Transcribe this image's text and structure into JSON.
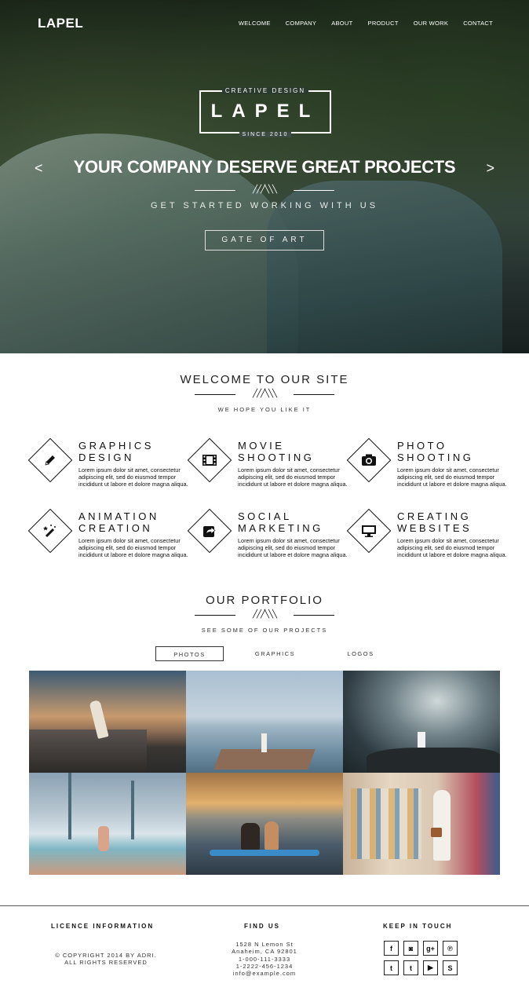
{
  "nav": {
    "logo": "LAPEL",
    "links": [
      "WELCOME",
      "COMPANY",
      "ABOUT",
      "PRODUCT",
      "OUR WORK",
      "CONTACT"
    ]
  },
  "hero": {
    "tagline": "CREATIVE DESIGN",
    "emblem": "LAPEL",
    "since": "SINCE 2010",
    "title": "YOUR COMPANY DESERVE GREAT PROJECTS",
    "subtitle": "GET STARTED WORKING WITH US",
    "button": "GATE OF ART",
    "prev": "<",
    "next": ">"
  },
  "welcome": {
    "title": "WELCOME TO OUR SITE",
    "subtitle": "WE HOPE YOU LIKE IT",
    "services": [
      {
        "line1": "GRAPHICS",
        "line2": "DESIGN",
        "icon": "pencil-icon",
        "desc": "Lorem ipsum dolor sit amet, consectetur adipiscing elit, sed do eiusmod tempor incididunt ut labore et dolore magna aliqua."
      },
      {
        "line1": "MOVIE",
        "line2": "SHOOTING",
        "icon": "film-icon",
        "desc": "Lorem ipsum dolor sit amet, consectetur adipiscing elit, sed do eiusmod tempor incididunt ut labore et dolore magna aliqua."
      },
      {
        "line1": "PHOTO",
        "line2": "SHOOTING",
        "icon": "camera-icon",
        "desc": "Lorem ipsum dolor sit amet, consectetur adipiscing elit, sed do eiusmod tempor incididunt ut labore et dolore magna aliqua."
      },
      {
        "line1": "ANIMATION",
        "line2": "CREATION",
        "icon": "magic-wand-icon",
        "desc": "Lorem ipsum dolor sit amet, consectetur adipiscing elit, sed do eiusmod tempor incididunt ut labore et dolore magna aliqua."
      },
      {
        "line1": "SOCIAL",
        "line2": "MARKETING",
        "icon": "share-icon",
        "desc": "Lorem ipsum dolor sit amet, consectetur adipiscing elit, sed do eiusmod tempor incididunt ut labore et dolore magna aliqua."
      },
      {
        "line1": "CREATING",
        "line2": "WEBSITES",
        "icon": "monitor-icon",
        "desc": "Lorem ipsum dolor sit amet, consectetur adipiscing elit, sed do eiusmod tempor incididunt ut labore et dolore magna aliqua."
      }
    ]
  },
  "portfolio": {
    "title": "OUR PORTFOLIO",
    "subtitle": "SEE SOME OF OUR  PROJECTS",
    "tabs": [
      "PHOTOS",
      "GRAPHICS",
      "LOGOS"
    ],
    "active_tab": "PHOTOS"
  },
  "footer": {
    "licence_title": "LICENCE INFORMATION",
    "copyright_line1": "© COPYRIGHT 2014 BY ADRI.",
    "copyright_line2": "ALL RIGHTS RESERVED",
    "find_title": "FIND US",
    "address1": "1528 N Lemon St",
    "address2": "Anaheim, CA 92801",
    "phone1": "1-000-111-3333",
    "phone2": "1-2222-456-1234",
    "email": "info@example.com",
    "keep_title": "KEEP IN TOUCH",
    "social": [
      {
        "glyph": "f",
        "icon": "facebook-icon"
      },
      {
        "glyph": "◙",
        "icon": "instagram-icon"
      },
      {
        "glyph": "g+",
        "icon": "google-plus-icon"
      },
      {
        "glyph": "℗",
        "icon": "pinterest-icon"
      },
      {
        "glyph": "t",
        "icon": "twitter-icon"
      },
      {
        "glyph": "t",
        "icon": "tumblr-icon"
      },
      {
        "glyph": "▶",
        "icon": "youtube-icon"
      },
      {
        "glyph": "S",
        "icon": "skype-icon"
      }
    ]
  }
}
